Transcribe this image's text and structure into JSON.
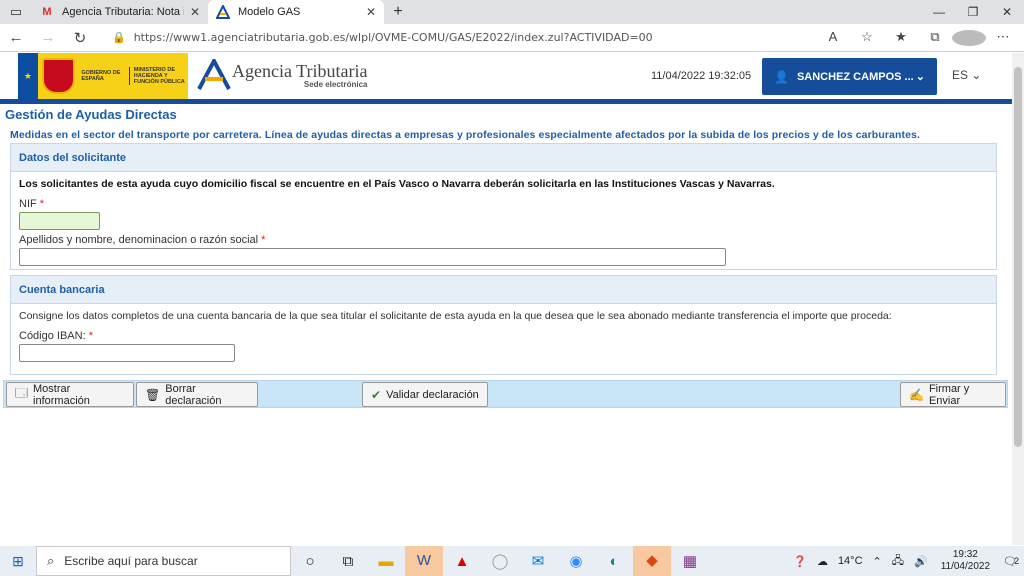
{
  "browser": {
    "tabs": [
      {
        "title": "Agencia Tributaria: Nota informa",
        "icon": "gmail-icon",
        "active": false
      },
      {
        "title": "Modelo GAS",
        "icon": "agencia-tributaria-icon",
        "active": true
      }
    ],
    "url": "https://www1.agenciatributaria.gob.es/wlpl/OVME-COMU/GAS/E2022/index.zul?ACTIVIDAD=00"
  },
  "header": {
    "gov_text": "GOBIERNO DE ESPAÑA",
    "ministry_text": "MINISTERIO DE HACIENDA Y FUNCIÓN PÚBLICA",
    "agency_name": "Agencia Tributaria",
    "agency_sub": "Sede electrónica",
    "datetime": "11/04/2022 19:32:05",
    "user": "SANCHEZ CAMPOS ...",
    "lang": "ES",
    "colors": {
      "brand_blue": "#154d9a",
      "title_blue": "#1e5fa8",
      "gov_yellow": "#f7d117"
    }
  },
  "page": {
    "title": "Gestión de Ayudas Directas",
    "subtitle": "Medidas en el sector del transporte por carretera. Línea de ayudas directas a empresas y profesionales especialmente afectados por la subida de los precios y de los carburantes."
  },
  "solicitante": {
    "heading": "Datos del solicitante",
    "notice": "Los solicitantes de esta ayuda cuyo domicilio fiscal se encuentre en el País Vasco o Navarra deberán solicitarla en las Instituciones Vascas y Navarras.",
    "nif_label": "NIF",
    "nif_value": "",
    "name_label": "Apellidos y nombre, denominacion o razón social",
    "name_value": "",
    "required_mark": "*"
  },
  "cuenta": {
    "heading": "Cuenta bancaria",
    "notice": "Consigne los datos completos de una cuenta bancaria de la que sea titular el solicitante de esta ayuda en la que desea que le sea abonado mediante transferencia el importe que proceda:",
    "iban_label": "Código IBAN:",
    "iban_value": ""
  },
  "actions": {
    "mostrar": "Mostrar información",
    "borrar": "Borrar declaración",
    "validar": "Validar declaración",
    "firmar": "Firmar y Enviar"
  },
  "taskbar": {
    "search_placeholder": "Escribe aquí para buscar",
    "temperature": "14°C",
    "time": "19:32",
    "date": "11/04/2022",
    "notifications": "2"
  }
}
